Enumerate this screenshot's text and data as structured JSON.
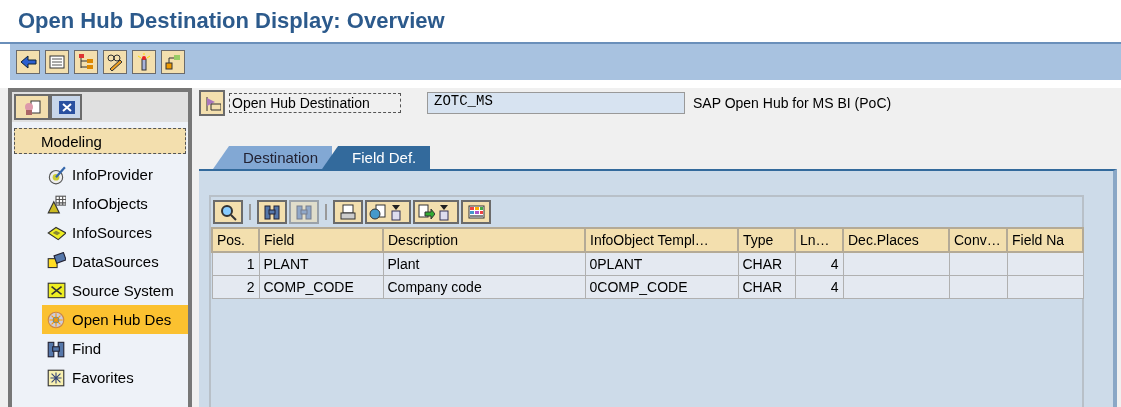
{
  "window": {
    "title": "Open Hub Destination Display: Overview"
  },
  "navigator": {
    "section": "Modeling",
    "items": [
      {
        "label": "InfoProvider",
        "selected": false
      },
      {
        "label": "InfoObjects",
        "selected": false
      },
      {
        "label": "InfoSources",
        "selected": false
      },
      {
        "label": "DataSources",
        "selected": false
      },
      {
        "label": "Source System",
        "selected": false
      },
      {
        "label": "Open Hub Des",
        "selected": true
      },
      {
        "label": "Find",
        "selected": false
      },
      {
        "label": "Favorites",
        "selected": false
      }
    ]
  },
  "header": {
    "label": "Open Hub Destination",
    "value": "ZOTC_MS",
    "description": "SAP Open Hub for MS BI (PoC)"
  },
  "tabs": [
    {
      "label": "Destination",
      "selected": false
    },
    {
      "label": "Field Def.",
      "selected": true
    }
  ],
  "table": {
    "columns": [
      "Pos.",
      "Field",
      "Description",
      "InfoObject Templ…",
      "Type",
      "Ln…",
      "Dec.Places",
      "Conv…",
      "Field Na"
    ],
    "rows": [
      [
        "1",
        "PLANT",
        "Plant",
        "0PLANT",
        "CHAR",
        "4"
      ],
      [
        "2",
        "COMP_CODE",
        "Company code",
        "0COMP_CODE",
        "CHAR",
        "4"
      ]
    ]
  }
}
